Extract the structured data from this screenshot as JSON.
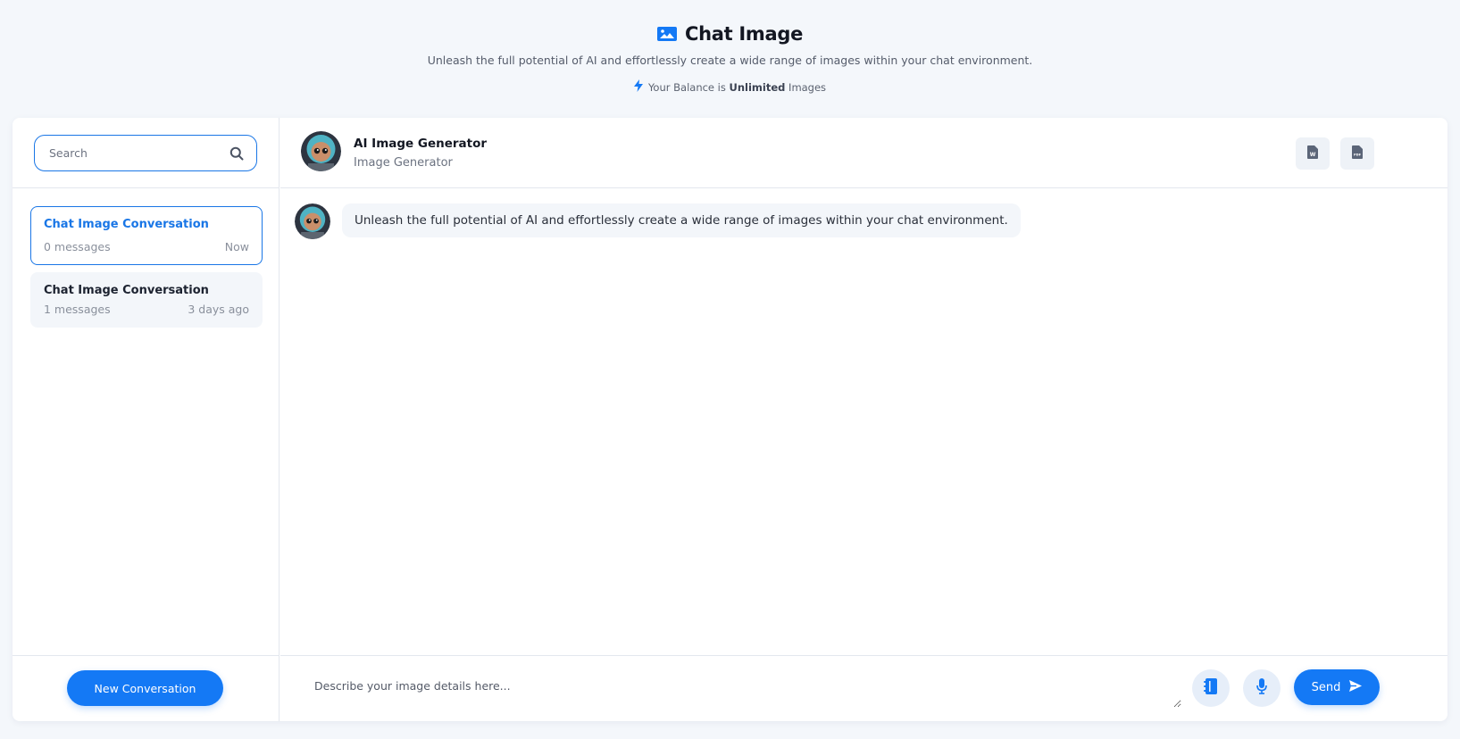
{
  "page": {
    "title": "Chat Image",
    "subtitle": "Unleash the full potential of AI and effortlessly create a wide range of images within your chat environment.",
    "balance_prefix": "Your Balance is ",
    "balance_value": "Unlimited",
    "balance_suffix": " Images",
    "accent_color": "#1479f5"
  },
  "search": {
    "placeholder": "Search"
  },
  "conversations": [
    {
      "title": "Chat Image Conversation",
      "count": "0 messages",
      "time": "Now",
      "active": true
    },
    {
      "title": "Chat Image Conversation",
      "count": "1 messages",
      "time": "3 days ago",
      "active": false
    }
  ],
  "sidebar": {
    "new_conversation_label": "New Conversation"
  },
  "chat_header": {
    "name": "AI Image Generator",
    "role": "Image Generator",
    "export_word_icon": "word-document-icon",
    "export_pdf_icon": "pdf-document-icon"
  },
  "messages": [
    {
      "sender": "bot",
      "text": "Unleash the full potential of AI and effortlessly create a wide range of images within your chat environment."
    }
  ],
  "composer": {
    "placeholder": "Describe your image details here...",
    "send_label": "Send",
    "library_icon": "prompt-library-icon",
    "mic_icon": "microphone-icon"
  }
}
